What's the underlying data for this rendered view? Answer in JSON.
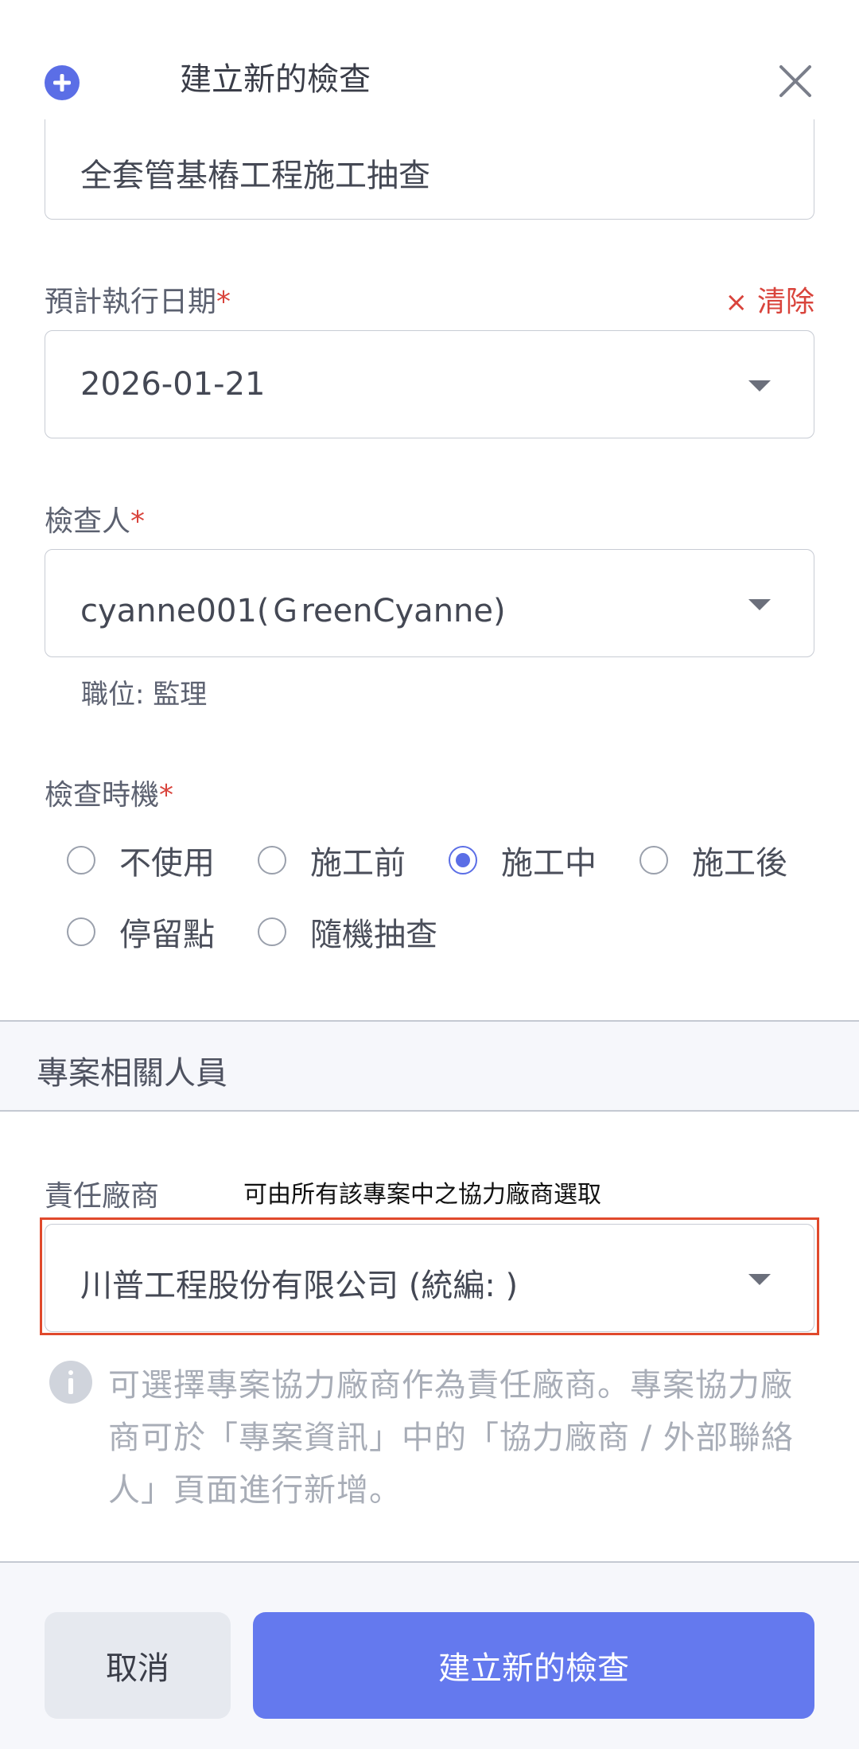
{
  "header": {
    "title": "建立新的檢查"
  },
  "inspection_name": {
    "value": "全套管基樁工程施工抽查"
  },
  "planned_date": {
    "label": "預計執行日期",
    "required_mark": "*",
    "value": "2026-01-21",
    "clear_icon": "×",
    "clear_label": "清除"
  },
  "inspector": {
    "label": "檢查人",
    "required_mark": "*",
    "value": "cyanne001(ＧreenCyanne)",
    "position_note": "職位: 監理"
  },
  "timing": {
    "label": "檢查時機",
    "required_mark": "*",
    "options": [
      "不使用",
      "施工前",
      "施工中",
      "施工後",
      "停留點",
      "隨機抽查"
    ],
    "selected": "施工中"
  },
  "section": {
    "title": "專案相關人員"
  },
  "contractor": {
    "label": "責任廠商",
    "hint": "可由所有該專案中之協力廠商選取",
    "value": "川普工程股份有限公司 (統編:                )",
    "info": "可選擇專案協力廠商作為責任廠商。專案協力廠商可於「專案資訊」中的「協力廠商 / 外部聯絡人」頁面進行新增。"
  },
  "footer": {
    "cancel_label": "取消",
    "create_label": "建立新的檢查"
  },
  "colors": {
    "accent": "#5b6ee6",
    "required": "#d9443c",
    "highlight": "#e0492c"
  }
}
